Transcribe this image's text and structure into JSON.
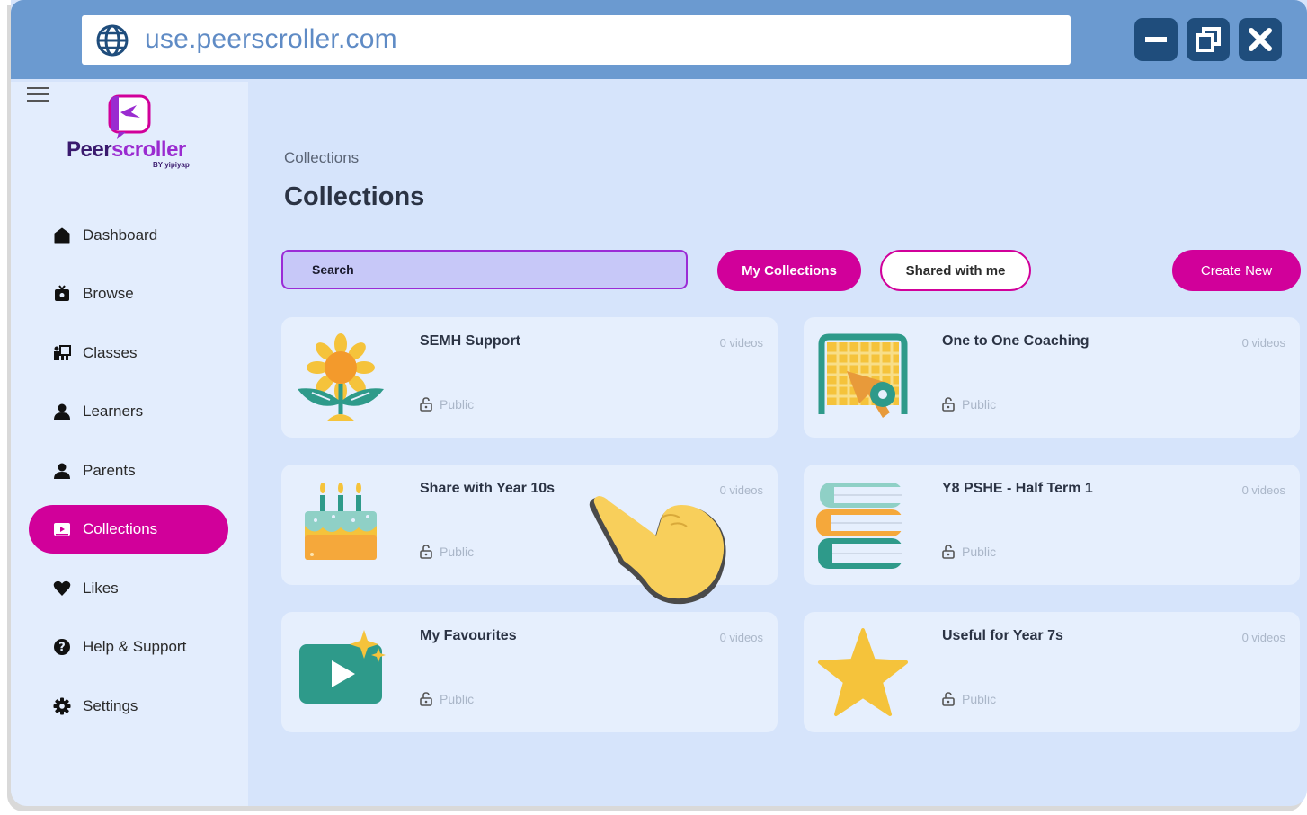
{
  "browser": {
    "url": "use.peerscroller.com"
  },
  "logo": {
    "name_part1": "Peer",
    "name_part2": "scroller",
    "tagline": "BY yipiyap"
  },
  "sidebar": {
    "items": [
      {
        "label": "Dashboard",
        "icon": "home-icon"
      },
      {
        "label": "Browse",
        "icon": "tv-icon"
      },
      {
        "label": "Classes",
        "icon": "classroom-icon"
      },
      {
        "label": "Learners",
        "icon": "person-icon"
      },
      {
        "label": "Parents",
        "icon": "person-icon"
      },
      {
        "label": "Collections",
        "icon": "collection-icon",
        "active": true
      },
      {
        "label": "Likes",
        "icon": "heart-icon"
      },
      {
        "label": "Help & Support",
        "icon": "help-icon"
      },
      {
        "label": "Settings",
        "icon": "gear-icon"
      }
    ]
  },
  "main": {
    "breadcrumb": "Collections",
    "title": "Collections",
    "search_label": "Search",
    "my_collections": "My Collections",
    "shared_with_me": "Shared with me",
    "create_new": "Create New"
  },
  "collections": [
    {
      "name": "SEMH Support",
      "count": "0 videos",
      "visibility": "Public",
      "icon": "sunflower-icon"
    },
    {
      "name": "One to One Coaching",
      "count": "0 videos",
      "visibility": "Public",
      "icon": "goal-icon"
    },
    {
      "name": "Share with Year 10s",
      "count": "0 videos",
      "visibility": "Public",
      "icon": "cake-icon"
    },
    {
      "name": "Y8 PSHE - Half Term 1",
      "count": "0 videos",
      "visibility": "Public",
      "icon": "books-icon"
    },
    {
      "name": "My Favourites",
      "count": "0 videos",
      "visibility": "Public",
      "icon": "video-icon"
    },
    {
      "name": "Useful for Year 7s",
      "count": "0 videos",
      "visibility": "Public",
      "icon": "star-icon"
    }
  ],
  "colors": {
    "accent": "#d1009a",
    "browser_bar": "#6b9ad0",
    "background": "#d6e4fb"
  }
}
